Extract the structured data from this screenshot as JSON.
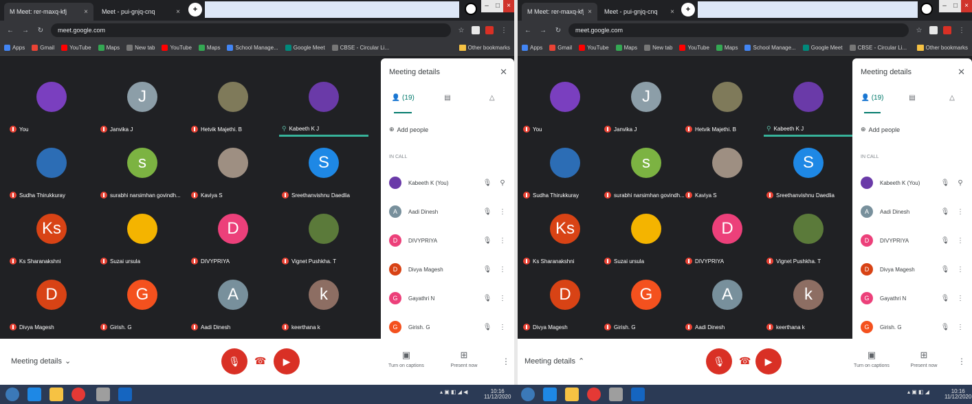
{
  "screens": [
    {
      "browser": {
        "tabs": [
          {
            "label": "M Meet: rer-maxq-kfj",
            "active": true
          },
          {
            "label": "Meet - pui-gnjq-cnq",
            "active": false
          }
        ],
        "url": "meet.google.com",
        "bookmarks": [
          "Apps",
          "Gmail",
          "YouTube",
          "Maps",
          "New tab",
          "YouTube",
          "Maps",
          "School Manage...",
          "Google Meet",
          "CBSE - Circular Li..."
        ],
        "other_bookmarks": "Other bookmarks"
      },
      "tiles": [
        {
          "name": "You",
          "initial": "",
          "color": "#7a3fbf",
          "speaking": false
        },
        {
          "name": "Janvika J",
          "initial": "J",
          "color": "#8c9ea8",
          "speaking": false
        },
        {
          "name": "Hetvik Majethi. B",
          "initial": "",
          "color": "#7f7a5a",
          "speaking": false
        },
        {
          "name": "Kabeeth K J",
          "initial": "",
          "color": "#6a3aa8",
          "speaking": true
        },
        {
          "name": "Sudha Thirukkuray",
          "initial": "",
          "color": "#2c6db5",
          "speaking": false
        },
        {
          "name": "surabhi narsimhan govindh...",
          "initial": "s",
          "color": "#7cb342",
          "speaking": false
        },
        {
          "name": "Kaviya S",
          "initial": "",
          "color": "#9e8f82",
          "speaking": false
        },
        {
          "name": "Sreethanvishnu Daedlia",
          "initial": "S",
          "color": "#1e88e5",
          "speaking": false
        },
        {
          "name": "Ks Sharanakshni",
          "initial": "Ks",
          "color": "#d84315",
          "speaking": false
        },
        {
          "name": "Suzai ursula",
          "initial": "",
          "color": "#f4b400",
          "speaking": false
        },
        {
          "name": "DIVYPRIYA",
          "initial": "D",
          "color": "#ec407a",
          "speaking": false
        },
        {
          "name": "Vignet Pushkha. T",
          "initial": "",
          "color": "#5b7a3a",
          "speaking": false
        },
        {
          "name": "Divya Magesh",
          "initial": "D",
          "color": "#d84315",
          "speaking": false
        },
        {
          "name": "Girish. G",
          "initial": "G",
          "color": "#f4511e",
          "speaking": false
        },
        {
          "name": "Aadi Dinesh",
          "initial": "A",
          "color": "#78909c",
          "speaking": false
        },
        {
          "name": "keerthana k",
          "initial": "k",
          "color": "#8d6e63",
          "speaking": false
        }
      ],
      "side_panel": {
        "title": "Meeting details",
        "tabs": [
          "(19)",
          "",
          ""
        ],
        "add_people": "Add people",
        "section": "IN CALL",
        "people": [
          {
            "name": "Kabeeth K (You)",
            "initial": "",
            "color": "#6a3aa8"
          },
          {
            "name": "Aadi Dinesh",
            "initial": "A",
            "color": "#78909c"
          },
          {
            "name": "DIVYPRIYA",
            "initial": "D",
            "color": "#ec407a"
          },
          {
            "name": "Divya Magesh",
            "initial": "D",
            "color": "#d84315"
          },
          {
            "name": "Gayathri N",
            "initial": "G",
            "color": "#ec407a"
          },
          {
            "name": "Girish. G",
            "initial": "G",
            "color": "#f4511e"
          }
        ]
      },
      "controls": {
        "meeting_details": "Meeting details",
        "captions": "Turn on captions",
        "present": "Present now"
      }
    },
    {
      "browser": {
        "tabs": [
          {
            "label": "M Meet: rer-maxq-kfj",
            "active": true
          },
          {
            "label": "Meet - pui-gnjq-cnq",
            "active": false
          }
        ],
        "url": "meet.google.com",
        "bookmarks": [
          "Apps",
          "Gmail",
          "YouTube",
          "Maps",
          "New tab",
          "YouTube",
          "Maps",
          "School Manage...",
          "Google Meet",
          "CBSE - Circular Li..."
        ],
        "other_bookmarks": "Other bookmarks"
      },
      "tiles": [
        {
          "name": "You",
          "initial": "",
          "color": "#7a3fbf",
          "speaking": false
        },
        {
          "name": "Janvika J",
          "initial": "J",
          "color": "#8c9ea8",
          "speaking": false
        },
        {
          "name": "Hetvik Majethi. B",
          "initial": "",
          "color": "#7f7a5a",
          "speaking": false
        },
        {
          "name": "Kabeeth K J",
          "initial": "",
          "color": "#6a3aa8",
          "speaking": true
        },
        {
          "name": "Sudha Thirukkuray",
          "initial": "",
          "color": "#2c6db5",
          "speaking": false
        },
        {
          "name": "surabhi narsimhan govindh...",
          "initial": "s",
          "color": "#7cb342",
          "speaking": false
        },
        {
          "name": "Kaviya S",
          "initial": "",
          "color": "#9e8f82",
          "speaking": false
        },
        {
          "name": "Sreethanvishnu Daedlia",
          "initial": "S",
          "color": "#1e88e5",
          "speaking": false
        },
        {
          "name": "Ks Sharanakshni",
          "initial": "Ks",
          "color": "#d84315",
          "speaking": false
        },
        {
          "name": "Suzai ursula",
          "initial": "",
          "color": "#f4b400",
          "speaking": false
        },
        {
          "name": "DIVYPRIYA",
          "initial": "D",
          "color": "#ec407a",
          "speaking": false
        },
        {
          "name": "Vignet Pushkha. T",
          "initial": "",
          "color": "#5b7a3a",
          "speaking": false
        },
        {
          "name": "Divya Magesh",
          "initial": "D",
          "color": "#d84315",
          "speaking": false
        },
        {
          "name": "Girish. G",
          "initial": "G",
          "color": "#f4511e",
          "speaking": false
        },
        {
          "name": "Aadi Dinesh",
          "initial": "A",
          "color": "#78909c",
          "speaking": false
        },
        {
          "name": "keerthana k",
          "initial": "k",
          "color": "#8d6e63",
          "speaking": false
        }
      ],
      "side_panel": {
        "title": "Meeting details",
        "tabs": [
          "(19)",
          "",
          ""
        ],
        "add_people": "Add people",
        "section": "IN CALL",
        "people": [
          {
            "name": "Kabeeth K (You)",
            "initial": "",
            "color": "#6a3aa8"
          },
          {
            "name": "Aadi Dinesh",
            "initial": "A",
            "color": "#78909c"
          },
          {
            "name": "DIVYPRIYA",
            "initial": "D",
            "color": "#ec407a"
          },
          {
            "name": "Divya Magesh",
            "initial": "D",
            "color": "#d84315"
          },
          {
            "name": "Gayathri N",
            "initial": "G",
            "color": "#ec407a"
          },
          {
            "name": "Girish. G",
            "initial": "G",
            "color": "#f4511e"
          }
        ]
      },
      "controls": {
        "meeting_details": "Meeting details",
        "captions": "Turn on captions",
        "present": "Present now"
      }
    }
  ],
  "taskbar": {
    "time": "10:16",
    "date": "11/12/2020",
    "time2": "10:16",
    "date2": "11/12/2020"
  },
  "icons": {
    "mic_off": "mic-off-icon",
    "hangup": "call-end-icon",
    "cam_off": "videocam-off-icon",
    "captions": "closed-caption-icon",
    "present": "present-to-all-icon",
    "more": "more-vert-icon"
  }
}
